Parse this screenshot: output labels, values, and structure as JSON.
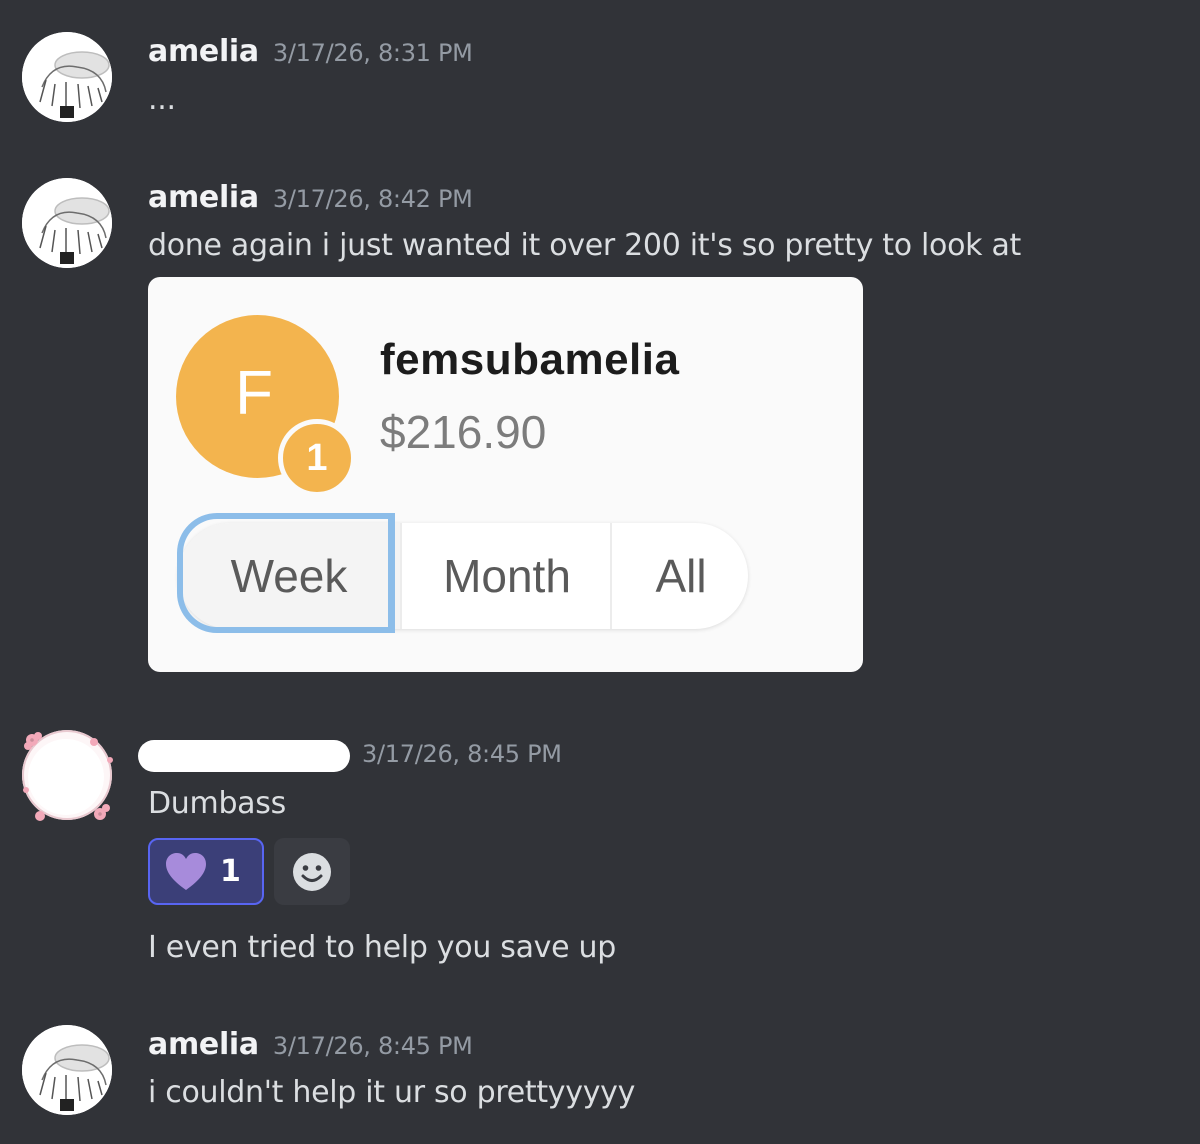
{
  "messages": [
    {
      "author": "amelia",
      "timestamp": "3/17/26, 8:31 PM",
      "content": "..."
    },
    {
      "author": "amelia",
      "timestamp": "3/17/26, 8:42 PM",
      "content": "done again i just wanted it over 200 it's so pretty to look at"
    },
    {
      "author": "",
      "timestamp": "3/17/26, 8:45 PM",
      "content": "Dumbass",
      "followup": "I even tried to help you save up"
    },
    {
      "author": "amelia",
      "timestamp": "3/17/26, 8:45 PM",
      "content": "i couldn't help it ur so prettyyyyy"
    }
  ],
  "embed": {
    "avatar_letter": "F",
    "badge_count": "1",
    "username": "femsubamelia",
    "amount": "$216.90",
    "tabs": [
      "Week",
      "Month",
      "All"
    ],
    "selected_tab": "Week",
    "accent_color": "#f3b44e"
  },
  "reaction": {
    "icon": "purple-heart-icon",
    "count": "1",
    "color": "#a78bdb"
  },
  "add_reaction_icon": "smiley-icon",
  "colors": {
    "background": "#313338",
    "reaction_border": "#5865f2",
    "focus_ring": "#8cbde9"
  }
}
